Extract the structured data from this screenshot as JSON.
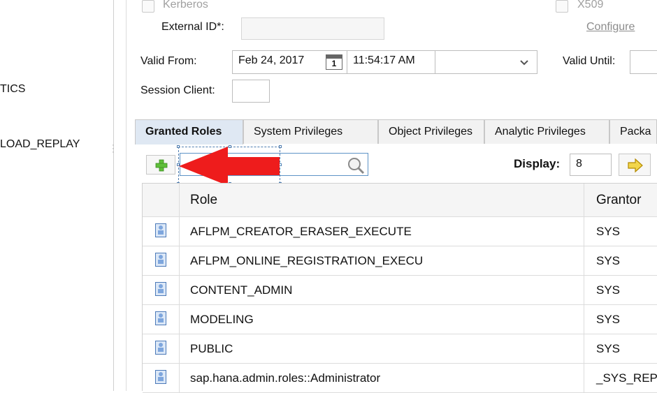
{
  "left_panel": {
    "items": [
      "TICS",
      "LOAD_REPLAY"
    ]
  },
  "auth": {
    "kerberos_label": "Kerberos",
    "x509_label": "X509",
    "external_id_label": "External ID*:",
    "external_id_value": "",
    "configure_link": "Configure"
  },
  "validity": {
    "valid_from_label": "Valid From:",
    "valid_from_date": "Feb 24, 2017",
    "calendar_day": "1",
    "valid_from_time": "11:54:17 AM",
    "timezone_value": "",
    "valid_until_label": "Valid Until:",
    "valid_until_value": ""
  },
  "session_client": {
    "label": "Session Client:",
    "value": ""
  },
  "tabs": [
    {
      "label": "Granted Roles",
      "active": true
    },
    {
      "label": "System Privileges",
      "active": false
    },
    {
      "label": "Object Privileges",
      "active": false
    },
    {
      "label": "Analytic Privileges",
      "active": false
    },
    {
      "label": "Packa",
      "active": false
    }
  ],
  "toolbar": {
    "search_value": "",
    "display_label": "Display:",
    "display_value": "8"
  },
  "table": {
    "columns": [
      "Role",
      "Grantor"
    ],
    "rows": [
      {
        "role": "AFLPM_CREATOR_ERASER_EXECUTE",
        "grantor": "SYS"
      },
      {
        "role": "AFLPM_ONLINE_REGISTRATION_EXECU",
        "grantor": "SYS"
      },
      {
        "role": "CONTENT_ADMIN",
        "grantor": "SYS"
      },
      {
        "role": "MODELING",
        "grantor": "SYS"
      },
      {
        "role": "PUBLIC",
        "grantor": "SYS"
      },
      {
        "role": "sap.hana.admin.roles::Administrator",
        "grantor": "_SYS_REPO"
      }
    ]
  },
  "icons": {
    "add": "plus-icon",
    "search": "magnifier-icon",
    "next": "arrow-right-icon",
    "calendar": "calendar-icon",
    "dropdown": "chevron-down-icon",
    "role": "role-icon",
    "annotation": "red-arrow-annotation"
  },
  "colors": {
    "active_tab": "#dfe8f3",
    "annotation_arrow": "#ee1c1c",
    "add_icon": "#5fbf3a",
    "next_icon": "#f2b705"
  }
}
